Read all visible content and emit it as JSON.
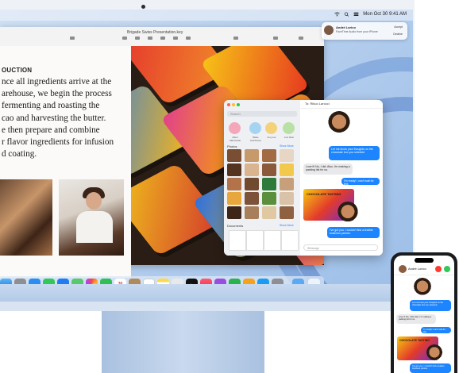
{
  "menubar": {
    "datetime": "Mon Oct 30  9:41 AM"
  },
  "pages": {
    "window_title": "Brigade Swiss Presentation.key",
    "toolbar": [
      "View",
      "Zoom",
      "Add Page",
      "Insert",
      "Table",
      "Chart",
      "Text",
      "Shape",
      "Media",
      "Comment",
      "Share",
      "Format",
      "Document"
    ],
    "doc_heading": "OUCTION",
    "doc_lines": [
      "nce all ingredients arrive at the",
      "arehouse, we begin the process",
      " fermenting and roasting the",
      "cao and harvesting the butter.",
      "e then prepare and combine",
      "r flavor ingredients for infusion",
      "d coating."
    ]
  },
  "notification": {
    "name": "André Lorico",
    "subtitle": "FaceTime Audio from your iPhone",
    "accept": "Accept",
    "decline": "Decline"
  },
  "messages": {
    "search_placeholder": "Search",
    "pins": [
      "Albert Zakrzewski",
      "Blake Hutchinson",
      "Cory Lee",
      "Luis Soler",
      "Beth Zhang"
    ],
    "photos_label": "Photos",
    "photos_more": "Show More",
    "documents_label": "Documents",
    "documents_more": "Show More",
    "recipient": "To: Rikuo Larocci",
    "bubbles": [
      {
        "dir": "out",
        "text": "Let me know your thoughts on the chocolate box you selected"
      },
      {
        "dir": "in",
        "text": "Love it! No, I did. Also, I'm making a packing list for us."
      },
      {
        "dir": "out",
        "text": "I'm ready! I can't wait for this"
      },
      {
        "dir": "in",
        "text": "I've got you. I couldn't find a leather business partner."
      }
    ],
    "input_placeholder": "iMessage",
    "sticker_text": "CHOCOLATE TASTING"
  },
  "iphone": {
    "contact": "André Lorico"
  },
  "dock": {
    "apps": [
      "Finder",
      "Launchpad",
      "Safari",
      "Messages",
      "Mail",
      "Maps",
      "Photos",
      "FaceTime",
      "Calendar",
      "Contacts",
      "Reminders",
      "Notes",
      "TV",
      "Music",
      "Podcasts",
      "Numbers",
      "Keynote",
      "Pages",
      "App Store",
      "System Settings",
      "Downloads",
      "Trash"
    ],
    "calendar_day": "30",
    "tv_label": "tv"
  },
  "colors": {
    "wallpaper": "#b6cfee",
    "imac_body": "#c7d9ef",
    "message_blue": "#1d85ff"
  }
}
